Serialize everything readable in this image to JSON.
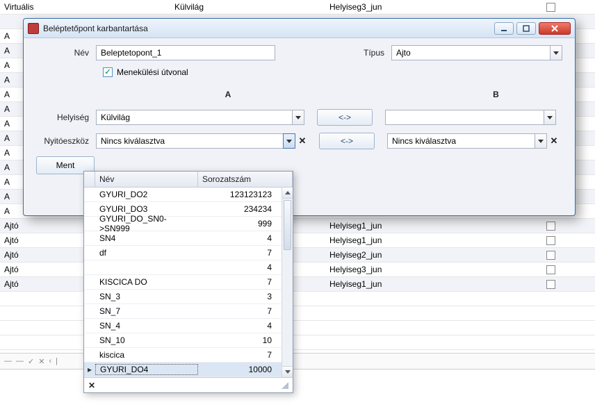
{
  "bg_rows": [
    {
      "c1": "Virtuális",
      "c2": "Külvilág",
      "c3": "Helyiseg3_jun",
      "alt": false
    },
    {
      "c1": "",
      "c2": "",
      "c3": "",
      "alt": true
    },
    {
      "c1": "A",
      "c2": "",
      "c3": "",
      "alt": false
    },
    {
      "c1": "A",
      "c2": "",
      "c3": "",
      "alt": true
    },
    {
      "c1": "A",
      "c2": "",
      "c3": "",
      "alt": false
    },
    {
      "c1": "A",
      "c2": "",
      "c3": "",
      "alt": true
    },
    {
      "c1": "A",
      "c2": "",
      "c3": "",
      "alt": false
    },
    {
      "c1": "A",
      "c2": "",
      "c3": "",
      "alt": true
    },
    {
      "c1": "A",
      "c2": "",
      "c3": "",
      "alt": false
    },
    {
      "c1": "A",
      "c2": "",
      "c3": "",
      "alt": true
    },
    {
      "c1": "A",
      "c2": "",
      "c3": "",
      "alt": false
    },
    {
      "c1": "A",
      "c2": "",
      "c3": "",
      "alt": true
    },
    {
      "c1": "A",
      "c2": "",
      "c3": "",
      "alt": false
    },
    {
      "c1": "A",
      "c2": "",
      "c3": "",
      "alt": true
    },
    {
      "c1": "A",
      "c2": "",
      "c3": "",
      "alt": false
    },
    {
      "c1": "Ajtó",
      "c2": "",
      "c3": "Helyiseg1_jun",
      "alt": true
    },
    {
      "c1": "Ajtó",
      "c2": "",
      "c3": "Helyiseg1_jun",
      "alt": false
    },
    {
      "c1": "Ajtó",
      "c2": "",
      "c3": "Helyiseg2_jun",
      "alt": true
    },
    {
      "c1": "Ajtó",
      "c2": "",
      "c3": "Helyiseg3_jun",
      "alt": false
    },
    {
      "c1": "Ajtó",
      "c2": "",
      "c3": "Helyiseg1_jun",
      "alt": true
    },
    {
      "c1": "",
      "c2": "",
      "c3": "",
      "alt": false
    },
    {
      "c1": "",
      "c2": "",
      "c3": "",
      "alt": false
    },
    {
      "c1": "",
      "c2": "",
      "c3": "",
      "alt": false
    },
    {
      "c1": "",
      "c2": "",
      "c3": "",
      "alt": false
    }
  ],
  "dialog": {
    "title": "Beléptetőpont karbantartása",
    "name_label": "Név",
    "name_value": "Beleptetopont_1",
    "type_label": "Típus",
    "type_value": "Ajto",
    "escape_label": "Menekülési útvonal",
    "escape_checked": true,
    "col_a": "A",
    "col_b": "B",
    "room_label": "Helyiség",
    "room_a_value": "Külvilág",
    "room_b_value": "",
    "opener_label": "Nyitóeszköz",
    "opener_placeholder": "Nincs kiválasztva",
    "opener_b_value": "Nincs kiválasztva",
    "swap_label": "<->",
    "save_label": "Ment",
    "clear_x": "✕"
  },
  "dropdown": {
    "col_name": "Név",
    "col_sn": "Sorozatszám",
    "footer_x": "✕",
    "rows": [
      {
        "name": "GYURI_DO2",
        "sn": "123123123",
        "sel": false
      },
      {
        "name": "GYURI_DO3",
        "sn": "234234",
        "sel": false
      },
      {
        "name": "GYURI_DO_SN0->SN999",
        "sn": "999",
        "sel": false
      },
      {
        "name": "SN4",
        "sn": "4",
        "sel": false
      },
      {
        "name": "df",
        "sn": "7",
        "sel": false
      },
      {
        "name": "",
        "sn": "4",
        "sel": false
      },
      {
        "name": "KISCICA DO",
        "sn": "7",
        "sel": false
      },
      {
        "name": "SN_3",
        "sn": "3",
        "sel": false
      },
      {
        "name": "SN_7",
        "sn": "7",
        "sel": false
      },
      {
        "name": "SN_4",
        "sn": "4",
        "sel": false
      },
      {
        "name": "SN_10",
        "sn": "10",
        "sel": false
      },
      {
        "name": "kiscica",
        "sn": "7",
        "sel": false
      },
      {
        "name": "GYURI_DO4",
        "sn": "10000",
        "sel": true
      }
    ]
  },
  "bottom": {
    "dash": "—",
    "check": "✓",
    "x": "✕",
    "left": "‹",
    "bar": "|"
  }
}
